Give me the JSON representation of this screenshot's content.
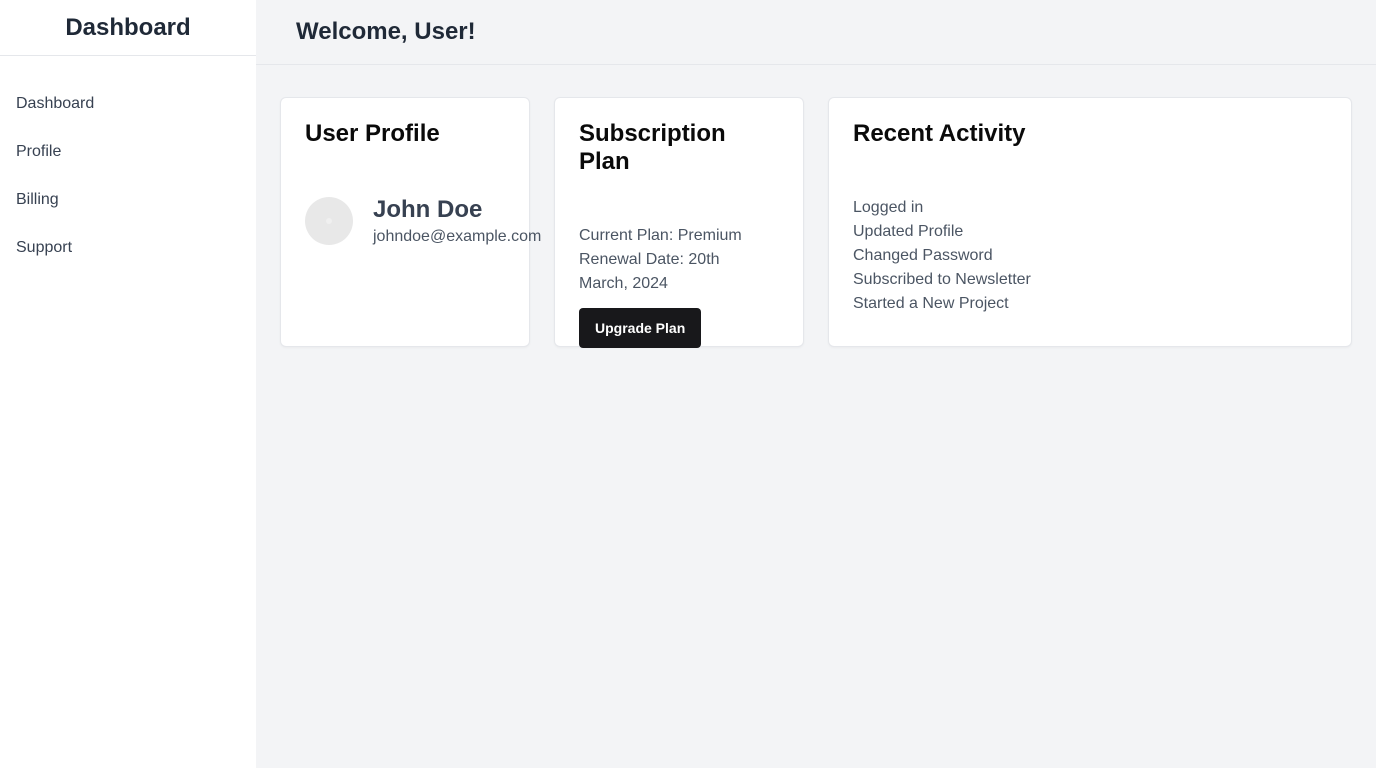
{
  "sidebar": {
    "title": "Dashboard",
    "items": [
      {
        "label": "Dashboard"
      },
      {
        "label": "Profile"
      },
      {
        "label": "Billing"
      },
      {
        "label": "Support"
      }
    ]
  },
  "header": {
    "welcome": "Welcome, User!"
  },
  "profile_card": {
    "title": "User Profile",
    "name": "John Doe",
    "email": "johndoe@example.com"
  },
  "subscription_card": {
    "title": "Subscription Plan",
    "current_plan": "Current Plan: Premium",
    "renewal_line1": "Renewal Date: 20th",
    "renewal_line2": "March, 2024",
    "button_label": "Upgrade Plan"
  },
  "activity_card": {
    "title": "Recent Activity",
    "items": [
      "Logged in",
      "Updated Profile",
      "Changed Password",
      "Subscribed to Newsletter",
      "Started a New Project"
    ]
  },
  "colors": {
    "background": "#f3f4f6",
    "sidebar": "#ffffff",
    "button": "#18181b"
  }
}
